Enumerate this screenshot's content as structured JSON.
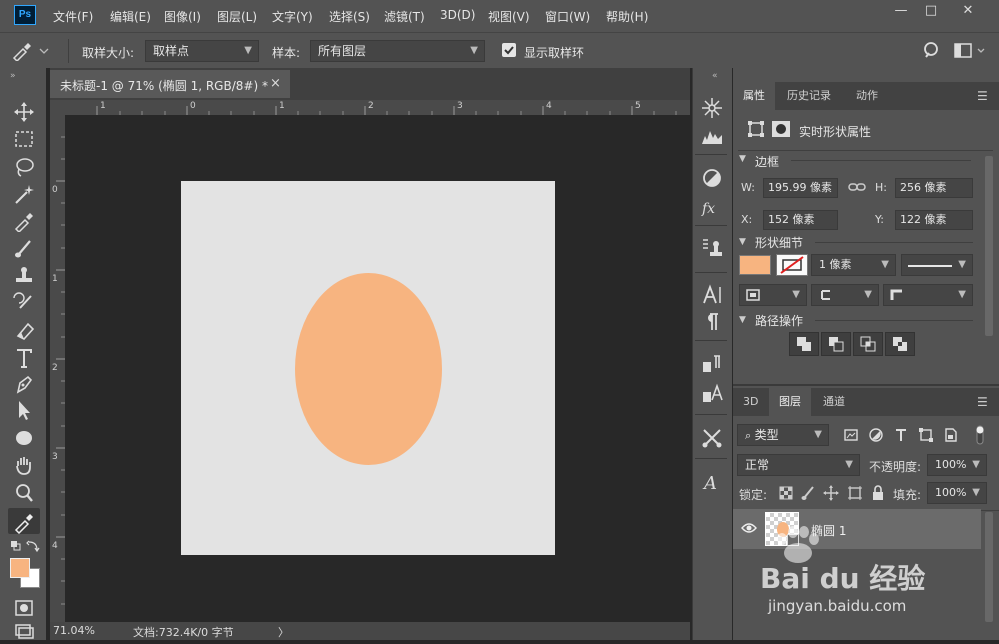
{
  "app": {
    "logo": "Ps"
  },
  "menu": [
    "文件(F)",
    "编辑(E)",
    "图像(I)",
    "图层(L)",
    "文字(Y)",
    "选择(S)",
    "滤镜(T)",
    "3D(D)",
    "视图(V)",
    "窗口(W)",
    "帮助(H)"
  ],
  "window_controls": {
    "minimize": "—",
    "restore": "□",
    "close": "✕"
  },
  "options": {
    "sample_size_label": "取样大小:",
    "sample_size_value": "取样点",
    "sample_label": "样本:",
    "sample_value": "所有图层",
    "show_ring_label": "显示取样环",
    "show_ring_checked": true
  },
  "document": {
    "tab_title": "未标题-1 @ 71% (椭圆 1, RGB/8#) *",
    "tab_close": "×",
    "ruler_h": [
      "1",
      "0",
      "1",
      "2",
      "3",
      "4",
      "5"
    ],
    "ruler_v": [
      "0",
      "1",
      "2",
      "3",
      "4"
    ],
    "canvas_color": "#e3e3e3",
    "ellipse_color": "#f7b480",
    "zoom": "71.04%",
    "doc_info": "文档:732.4K/0 字节",
    "status_arrow": "〉"
  },
  "properties_panel": {
    "tabs": [
      "属性",
      "历史记录",
      "动作"
    ],
    "title": "实时形状属性",
    "section_bounds": "边框",
    "w_label": "W:",
    "w_value": "195.99 像素",
    "h_label": "H:",
    "h_value": "256 像素",
    "x_label": "X:",
    "x_value": "152 像素",
    "y_label": "Y:",
    "y_value": "122 像素",
    "section_shape": "形状细节",
    "stroke_width": "1 像素",
    "section_path": "路径操作"
  },
  "layers_panel": {
    "tabs": [
      "3D",
      "图层",
      "通道"
    ],
    "filter": "类型",
    "blend_mode": "正常",
    "opacity_label": "不透明度:",
    "opacity_value": "100%",
    "lock_label": "锁定:",
    "fill_label": "填充:",
    "fill_value": "100%",
    "layer_name": "椭圆 1"
  },
  "watermark": {
    "brand": "Bai du 经验",
    "url": "jingyan.baidu.com"
  },
  "colors": {
    "foreground": "#f7b480",
    "background": "#ffffff",
    "accent": "#31a8ff"
  }
}
